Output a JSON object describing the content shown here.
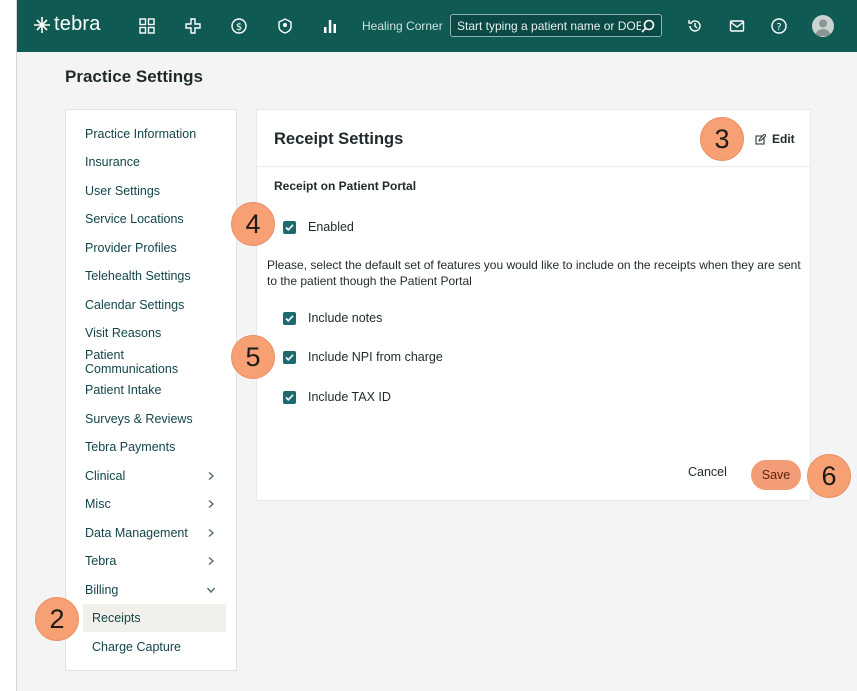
{
  "app": {
    "logo_text": "tebra",
    "practice_name": "Healing Corner"
  },
  "search": {
    "placeholder": "Start typing a patient name or DOB"
  },
  "page": {
    "title": "Practice Settings"
  },
  "sidebar": {
    "items": [
      {
        "label": "Practice Information"
      },
      {
        "label": "Insurance"
      },
      {
        "label": "User Settings"
      },
      {
        "label": "Service Locations"
      },
      {
        "label": "Provider Profiles"
      },
      {
        "label": "Telehealth Settings"
      },
      {
        "label": "Calendar Settings"
      },
      {
        "label": "Visit Reasons"
      },
      {
        "label": "Patient Communications"
      },
      {
        "label": "Patient Intake"
      },
      {
        "label": "Surveys & Reviews"
      },
      {
        "label": "Tebra Payments"
      },
      {
        "label": "Clinical",
        "chevron": "chevron-right-icon"
      },
      {
        "label": "Misc",
        "chevron": "chevron-right-icon"
      },
      {
        "label": "Data Management",
        "chevron": "chevron-right-icon"
      },
      {
        "label": "Tebra",
        "chevron": "chevron-right-icon"
      },
      {
        "label": "Billing",
        "chevron": "chevron-down-icon"
      },
      {
        "label": "Receipts",
        "selected": true
      },
      {
        "label": "Charge Capture"
      }
    ]
  },
  "panel": {
    "title": "Receipt Settings",
    "edit_label": "Edit",
    "section_label": "Receipt on Patient Portal",
    "enabled": {
      "label": "Enabled",
      "checked": true
    },
    "description": "Please, select the default set of features you would like to include on the receipts when they are sent to the patient though the Patient Portal",
    "options": [
      {
        "label": "Include notes",
        "checked": true
      },
      {
        "label": "Include NPI from charge",
        "checked": true
      },
      {
        "label": "Include TAX ID",
        "checked": true
      }
    ],
    "cancel_label": "Cancel",
    "save_label": "Save"
  },
  "markers": [
    "2",
    "3",
    "4",
    "5",
    "6"
  ],
  "colors": {
    "topbar": "#0f5a52",
    "accent": "#1b6a70",
    "save_button": "#f39c78",
    "marker": "#f7a074"
  }
}
